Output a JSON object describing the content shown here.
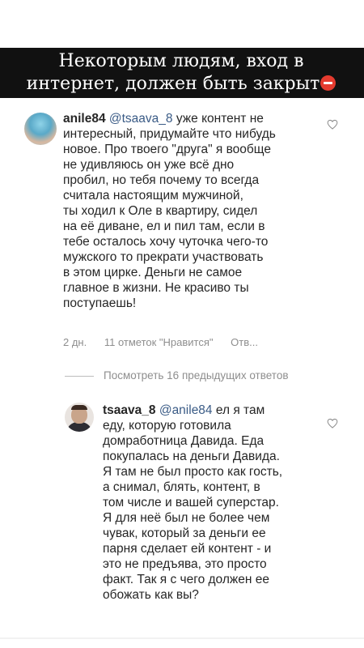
{
  "banner": {
    "line1": "Некоторым людям, вход в",
    "line2": "интернет, должен быть закрыт"
  },
  "comment1": {
    "username": "anile84",
    "mention": "@tsaava_8",
    "text": "уже контент не\nинтересный, придумайте что нибудь\nновое. Про твоего \"друга\" я вообще\nне удивляюсь он уже всё дно\nпробил, но тебя почему то всегда\nсчитала настоящим мужчиной,\nты ходил к Оле в квартиру, сидел\nна её диване, ел и пил там, если в\nтебе осталось хочу чуточка чего-то\nмужского то прекрати участвовать\nв этом цирке. Деньги не самое\nглавное в жизни. Не красиво ты\nпоступаешь!",
    "time": "2 дн.",
    "likes": "11 отметок \"Нравится\"",
    "reply": "Отв..."
  },
  "view_previous": "Посмотреть 16 предыдущих ответов",
  "comment2": {
    "username": "tsaava_8",
    "mention": "@anile84",
    "text": "ел я там\nеду, которую готовила\nдомработница Давида. Еда\nпокупалась на деньги Давида.\nЯ там не был просто как гость,\nа снимал, блять, контент, в\nтом числе и вашей суперстар.\nЯ для неё был не более чем\nчувак, который за деньги ее\nпарня сделает ей контент - и\nэто не предъява, это просто\nфакт. Так я с чего должен ее\nобожать как вы?"
  },
  "icons": {
    "stop": "stop-sign-icon",
    "heart": "heart-outline-icon"
  },
  "colors": {
    "banner_bg": "#111111",
    "mention": "#3a5b86",
    "meta": "#8e8e8e"
  }
}
